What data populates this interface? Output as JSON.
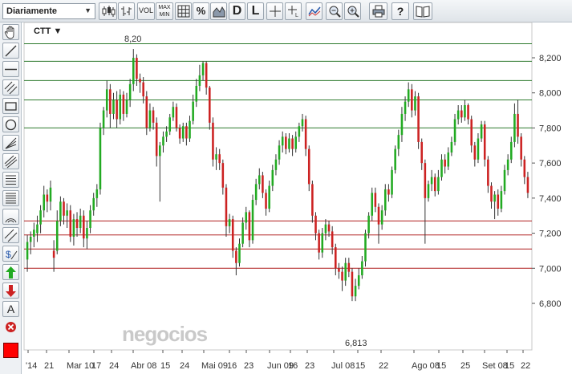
{
  "toolbar": {
    "period": "Diariamente",
    "vol": "VOL",
    "max": "MAX",
    "min": "MIN",
    "pct": "%",
    "d": "D",
    "l": "L"
  },
  "ticker": "CTT ▼",
  "watermark": "negocios",
  "colors": {
    "up": "#22aa22",
    "down": "#cc2222",
    "green_line": "#2d7a2d",
    "red_line": "#b02020"
  },
  "chart_data": {
    "type": "candlestick",
    "ylim": [
      6600,
      8300
    ],
    "y_ticks": [
      6800,
      7000,
      7200,
      7400,
      7600,
      7800,
      8000,
      8200
    ],
    "y_tick_labels": [
      "6,800",
      "7,000",
      "7,200",
      "7,400",
      "7,600",
      "7,800",
      "8,000",
      "8,200"
    ],
    "x_tick_labels": [
      "'14",
      "21",
      "Mar 10",
      "17",
      "24",
      "Abr 08",
      "15",
      "24",
      "Mai 09",
      "16",
      "23",
      "Jun 09",
      "16",
      "23",
      "Jul 08",
      "15",
      "22",
      "Ago 08",
      "15",
      "25",
      "Set 08",
      "15",
      "22"
    ],
    "annotations": [
      {
        "label": "8,20",
        "value": 8200
      },
      {
        "label": "6,813",
        "value": 6813
      }
    ],
    "horizontal_levels_green": [
      8280,
      8180,
      8070,
      7960,
      7800
    ],
    "horizontal_levels_red": [
      7270,
      7190,
      7110,
      7000
    ],
    "candles": [
      [
        7050,
        7150,
        6980,
        7190
      ],
      [
        7150,
        7180,
        7080,
        7210
      ],
      [
        7180,
        7220,
        7120,
        7260
      ],
      [
        7200,
        7250,
        7150,
        7300
      ],
      [
        7250,
        7330,
        7200,
        7360
      ],
      [
        7330,
        7420,
        7290,
        7470
      ],
      [
        7420,
        7380,
        7320,
        7450
      ],
      [
        7380,
        7460,
        7330,
        7500
      ],
      [
        7100,
        7060,
        6980,
        7160
      ],
      [
        7100,
        7270,
        7080,
        7330
      ],
      [
        7270,
        7380,
        7240,
        7410
      ],
      [
        7380,
        7300,
        7250,
        7400
      ],
      [
        7300,
        7330,
        7230,
        7370
      ],
      [
        7330,
        7180,
        7150,
        7360
      ],
      [
        7180,
        7280,
        7130,
        7310
      ],
      [
        7280,
        7230,
        7180,
        7320
      ],
      [
        7230,
        7300,
        7200,
        7340
      ],
      [
        7300,
        7170,
        7120,
        7330
      ],
      [
        7170,
        7230,
        7110,
        7270
      ],
      [
        7230,
        7330,
        7200,
        7360
      ],
      [
        7330,
        7400,
        7300,
        7430
      ],
      [
        7400,
        7450,
        7350,
        7480
      ],
      [
        7450,
        7800,
        7420,
        7830
      ],
      [
        7800,
        7900,
        7760,
        7920
      ],
      [
        7900,
        8020,
        7860,
        8070
      ],
      [
        8020,
        7880,
        7800,
        8050
      ],
      [
        7880,
        7960,
        7850,
        8000
      ],
      [
        7960,
        7850,
        7800,
        8010
      ],
      [
        7850,
        7990,
        7820,
        8020
      ],
      [
        7990,
        7880,
        7840,
        8010
      ],
      [
        7880,
        7960,
        7860,
        8000
      ],
      [
        7960,
        8050,
        7920,
        8080
      ],
      [
        8050,
        8200,
        8010,
        8250
      ],
      [
        8200,
        8080,
        8040,
        8220
      ],
      [
        8080,
        8060,
        8000,
        8110
      ],
      [
        8060,
        7980,
        7940,
        8090
      ],
      [
        7980,
        7800,
        7760,
        8010
      ],
      [
        7800,
        7900,
        7780,
        7940
      ],
      [
        7900,
        7830,
        7790,
        7920
      ],
      [
        7830,
        7640,
        7580,
        7860
      ],
      [
        7640,
        7700,
        7380,
        7720
      ],
      [
        7700,
        7750,
        7660,
        7780
      ],
      [
        7750,
        7780,
        7720,
        7810
      ],
      [
        7780,
        7860,
        7760,
        7880
      ],
      [
        7860,
        7920,
        7840,
        7950
      ],
      [
        7920,
        7800,
        7780,
        7940
      ],
      [
        7800,
        7740,
        7710,
        7820
      ],
      [
        7740,
        7810,
        7720,
        7830
      ],
      [
        7810,
        7740,
        7700,
        7830
      ],
      [
        7740,
        7840,
        7720,
        7870
      ],
      [
        7840,
        7950,
        7820,
        7990
      ],
      [
        7950,
        8040,
        7920,
        8080
      ],
      [
        8040,
        8100,
        8010,
        8160
      ],
      [
        8100,
        8170,
        8070,
        8180
      ],
      [
        8170,
        8030,
        7990,
        8180
      ],
      [
        8030,
        7830,
        7790,
        8040
      ],
      [
        7830,
        7620,
        7580,
        7860
      ],
      [
        7620,
        7650,
        7560,
        7690
      ],
      [
        7650,
        7600,
        7560,
        7680
      ],
      [
        7600,
        7460,
        7420,
        7620
      ],
      [
        7460,
        7240,
        7180,
        7480
      ],
      [
        7240,
        7280,
        7200,
        7310
      ],
      [
        7280,
        7100,
        7060,
        7300
      ],
      [
        7100,
        7030,
        6960,
        7120
      ],
      [
        7030,
        7140,
        7010,
        7170
      ],
      [
        7140,
        7260,
        7120,
        7290
      ],
      [
        7260,
        7320,
        7220,
        7350
      ],
      [
        7320,
        7160,
        7120,
        7330
      ],
      [
        7160,
        7390,
        7140,
        7420
      ],
      [
        7390,
        7480,
        7360,
        7510
      ],
      [
        7480,
        7530,
        7450,
        7570
      ],
      [
        7530,
        7430,
        7400,
        7550
      ],
      [
        7430,
        7340,
        7300,
        7450
      ],
      [
        7340,
        7470,
        7320,
        7500
      ],
      [
        7470,
        7560,
        7440,
        7590
      ],
      [
        7560,
        7620,
        7530,
        7650
      ],
      [
        7620,
        7700,
        7590,
        7730
      ],
      [
        7700,
        7750,
        7660,
        7780
      ],
      [
        7750,
        7680,
        7650,
        7770
      ],
      [
        7680,
        7740,
        7660,
        7770
      ],
      [
        7740,
        7680,
        7640,
        7760
      ],
      [
        7680,
        7750,
        7660,
        7780
      ],
      [
        7750,
        7810,
        7720,
        7830
      ],
      [
        7810,
        7850,
        7780,
        7880
      ],
      [
        7850,
        7680,
        7640,
        7870
      ],
      [
        7680,
        7480,
        7440,
        7700
      ],
      [
        7480,
        7300,
        7260,
        7500
      ],
      [
        7300,
        7200,
        7160,
        7320
      ],
      [
        7200,
        7090,
        7050,
        7220
      ],
      [
        7090,
        7200,
        7060,
        7230
      ],
      [
        7200,
        7250,
        7160,
        7280
      ],
      [
        7250,
        7210,
        7180,
        7270
      ],
      [
        7210,
        7120,
        7080,
        7240
      ],
      [
        7120,
        7000,
        6960,
        7140
      ],
      [
        7000,
        6980,
        6940,
        7030
      ],
      [
        6980,
        6930,
        6870,
        7010
      ],
      [
        6930,
        7030,
        6900,
        7060
      ],
      [
        7030,
        6980,
        6950,
        7060
      ],
      [
        6980,
        6840,
        6813,
        7000
      ],
      [
        6840,
        6900,
        6813,
        6940
      ],
      [
        6900,
        6960,
        6880,
        7000
      ],
      [
        6960,
        7040,
        6940,
        7070
      ],
      [
        7040,
        7200,
        7010,
        7220
      ],
      [
        7200,
        7300,
        7170,
        7320
      ],
      [
        7300,
        7430,
        7270,
        7460
      ],
      [
        7430,
        7350,
        7320,
        7460
      ],
      [
        7350,
        7250,
        7140,
        7370
      ],
      [
        7250,
        7330,
        7220,
        7360
      ],
      [
        7330,
        7450,
        7300,
        7480
      ],
      [
        7450,
        7420,
        7380,
        7480
      ],
      [
        7420,
        7560,
        7400,
        7580
      ],
      [
        7560,
        7680,
        7540,
        7700
      ],
      [
        7680,
        7760,
        7640,
        7790
      ],
      [
        7760,
        7880,
        7720,
        7920
      ],
      [
        7880,
        7950,
        7840,
        7980
      ],
      [
        7950,
        8020,
        7920,
        8060
      ],
      [
        8020,
        7900,
        7860,
        8050
      ],
      [
        7900,
        7980,
        7870,
        8010
      ],
      [
        7980,
        7720,
        7680,
        8000
      ],
      [
        7720,
        7600,
        7560,
        7740
      ],
      [
        7600,
        7400,
        7140,
        7620
      ],
      [
        7400,
        7480,
        7380,
        7500
      ],
      [
        7480,
        7520,
        7440,
        7560
      ],
      [
        7520,
        7440,
        7410,
        7540
      ],
      [
        7440,
        7520,
        7420,
        7560
      ],
      [
        7520,
        7620,
        7500,
        7650
      ],
      [
        7620,
        7580,
        7540,
        7650
      ],
      [
        7580,
        7660,
        7560,
        7690
      ],
      [
        7660,
        7720,
        7640,
        7750
      ],
      [
        7720,
        7850,
        7700,
        7880
      ],
      [
        7850,
        7900,
        7820,
        7930
      ],
      [
        7900,
        7860,
        7830,
        7930
      ],
      [
        7860,
        7930,
        7840,
        7960
      ],
      [
        7930,
        7850,
        7820,
        7940
      ],
      [
        7850,
        7700,
        7660,
        7870
      ],
      [
        7700,
        7620,
        7580,
        7720
      ],
      [
        7620,
        7740,
        7600,
        7770
      ],
      [
        7740,
        7820,
        7720,
        7840
      ],
      [
        7820,
        7620,
        7580,
        7840
      ],
      [
        7620,
        7470,
        7430,
        7640
      ],
      [
        7470,
        7380,
        7340,
        7490
      ],
      [
        7380,
        7420,
        7280,
        7440
      ],
      [
        7420,
        7340,
        7300,
        7450
      ],
      [
        7340,
        7440,
        7320,
        7470
      ],
      [
        7440,
        7560,
        7420,
        7590
      ],
      [
        7560,
        7620,
        7530,
        7650
      ],
      [
        7620,
        7720,
        7600,
        7750
      ],
      [
        7720,
        7880,
        7690,
        7940
      ],
      [
        7880,
        7750,
        7710,
        7960
      ],
      [
        7750,
        7620,
        7580,
        7770
      ],
      [
        7620,
        7520,
        7480,
        7640
      ],
      [
        7520,
        7430,
        7400,
        7550
      ]
    ]
  }
}
